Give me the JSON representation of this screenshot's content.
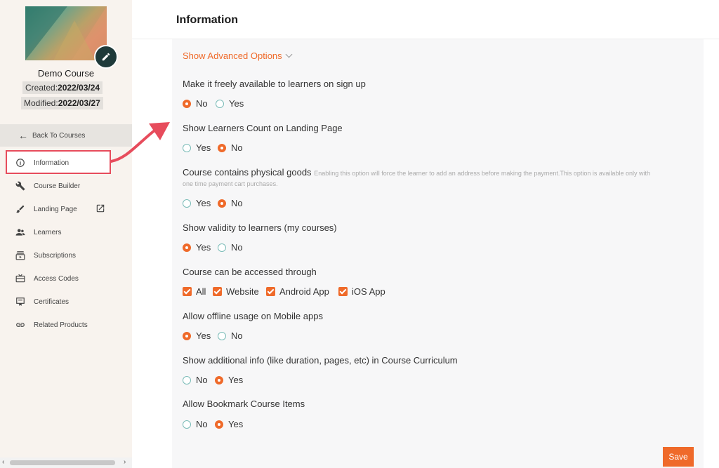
{
  "sidebar": {
    "course_name": "Demo Course",
    "created_label": "Created:",
    "created_value": "2022/03/24",
    "modified_label": "Modified:",
    "modified_value": "2022/03/27",
    "back_label": "Back To Courses",
    "items": [
      {
        "label": "Information",
        "icon": "info-icon"
      },
      {
        "label": "Course Builder",
        "icon": "wrench-icon"
      },
      {
        "label": "Landing Page",
        "icon": "brush-icon"
      },
      {
        "label": "Learners",
        "icon": "people-icon"
      },
      {
        "label": "Subscriptions",
        "icon": "subscriptions-icon"
      },
      {
        "label": "Access Codes",
        "icon": "ticket-icon"
      },
      {
        "label": "Certificates",
        "icon": "certificate-icon"
      },
      {
        "label": "Related Products",
        "icon": "link-icon"
      }
    ]
  },
  "header": {
    "title": "Information"
  },
  "main": {
    "advanced_toggle": "Show Advanced Options",
    "questions": [
      {
        "label": "Make it freely available to learners on sign up",
        "options": [
          "No",
          "Yes"
        ],
        "selected": "No"
      },
      {
        "label": "Show Learners Count on Landing Page",
        "options": [
          "Yes",
          "No"
        ],
        "selected": "No"
      },
      {
        "label": "Course contains physical goods",
        "hint": "Enabling this option will force the learner to add an address before making the payment.This option is available only with",
        "hint2": "one time payment cart purchases.",
        "options": [
          "Yes",
          "No"
        ],
        "selected": "No"
      },
      {
        "label": "Show validity to learners (my courses)",
        "options": [
          "Yes",
          "No"
        ],
        "selected": "Yes"
      },
      {
        "label": "Course can be accessed through",
        "checkboxes": [
          "All",
          "Website",
          "Android App",
          "iOS App"
        ]
      },
      {
        "label": "Allow offline usage on Mobile apps",
        "options": [
          "Yes",
          "No"
        ],
        "selected": "Yes"
      },
      {
        "label": "Show additional info (like duration, pages, etc) in Course Curriculum",
        "options": [
          "No",
          "Yes"
        ],
        "selected": "Yes"
      },
      {
        "label": "Allow Bookmark Course Items",
        "options": [
          "No",
          "Yes"
        ],
        "selected": "Yes"
      }
    ],
    "save_label": "Save"
  },
  "colors": {
    "accent": "#ef6a2a",
    "highlight": "#e74c5c",
    "sidebar_bg": "#f8f3ee"
  }
}
